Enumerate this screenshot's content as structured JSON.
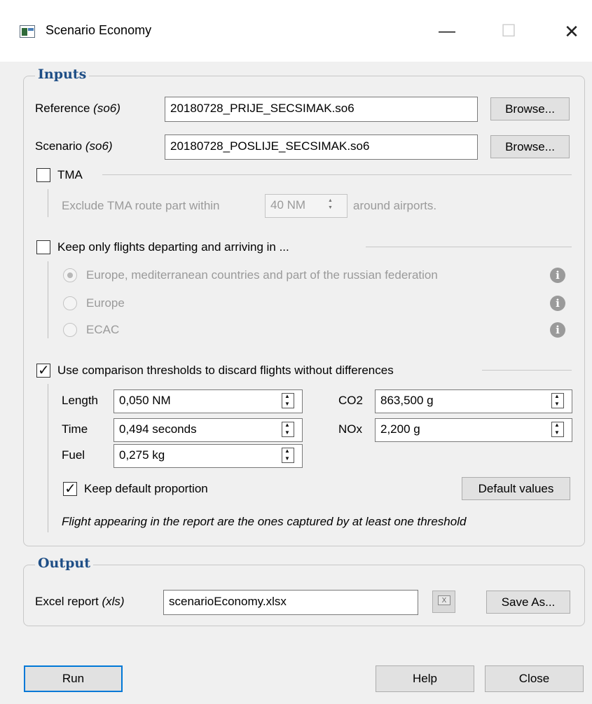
{
  "window": {
    "title": "Scenario Economy",
    "minimize": "—",
    "maximize": "☐",
    "close": "✕"
  },
  "inputs": {
    "group_title": "Inputs",
    "reference": {
      "label": "Reference",
      "hint": "(so6)",
      "value": "20180728_PRIJE_SECSIMAK.so6",
      "browse": "Browse..."
    },
    "scenario": {
      "label": "Scenario",
      "hint": "(so6)",
      "value": "20180728_POSLIJE_SECSIMAK.so6",
      "browse": "Browse..."
    },
    "tma": {
      "label": "TMA",
      "checked": false,
      "exclude_label": "Exclude TMA route part within",
      "distance": "40 NM",
      "around_label": "around airports."
    },
    "keep_only": {
      "label": "Keep only flights departing and arriving in ...",
      "checked": false,
      "options": [
        {
          "label": "Europe, mediterranean countries and part of the russian federation",
          "selected": true
        },
        {
          "label": "Europe",
          "selected": false
        },
        {
          "label": "ECAC",
          "selected": false
        }
      ],
      "info_glyph": "i"
    },
    "thresholds": {
      "label": "Use comparison thresholds to discard flights without differences",
      "checked": true,
      "length": {
        "label": "Length",
        "value": "0,050 NM"
      },
      "time": {
        "label": "Time",
        "value": "0,494 seconds"
      },
      "fuel": {
        "label": "Fuel",
        "value": "0,275 kg"
      },
      "co2": {
        "label": "CO2",
        "value": "863,500 g"
      },
      "nox": {
        "label": "NOx",
        "value": "2,200 g"
      },
      "keep_proportion": {
        "label": "Keep default proportion",
        "checked": true
      },
      "default_values": "Default values",
      "note": "Flight appearing in the report are the ones captured by at least one threshold"
    }
  },
  "output": {
    "group_title": "Output",
    "excel": {
      "label": "Excel report",
      "hint": "(xls)",
      "value": "scenarioEconomy.xlsx",
      "save_as": "Save As...",
      "icon_glyph": "X"
    }
  },
  "footer": {
    "run": "Run",
    "help": "Help",
    "close": "Close"
  }
}
